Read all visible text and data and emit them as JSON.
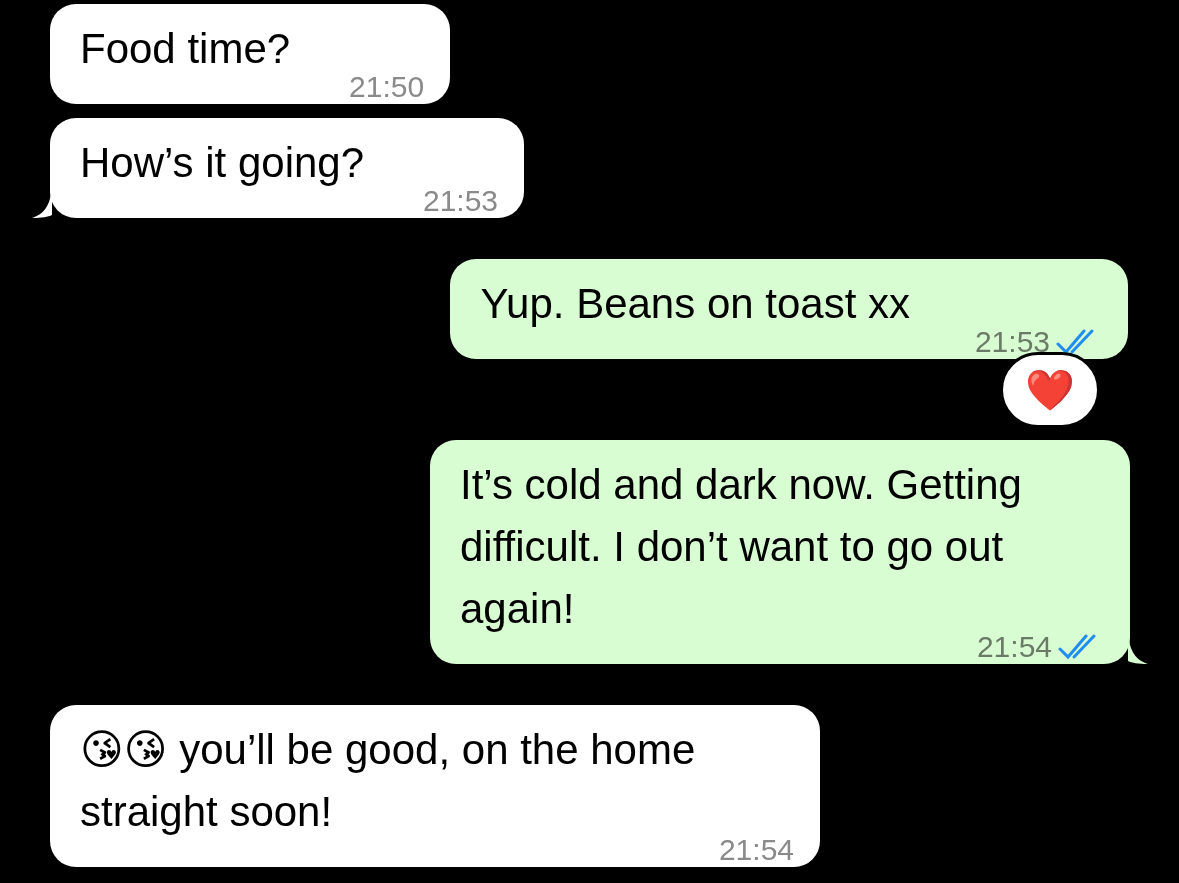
{
  "messages": [
    {
      "kind": "incoming",
      "text": "Food time?",
      "time": "21:50",
      "tail": false
    },
    {
      "kind": "incoming",
      "text": "How’s it going?",
      "time": "21:53",
      "tail": true
    },
    {
      "kind": "outgoing",
      "text": "Yup. Beans on toast xx",
      "time": "21:53",
      "read": true,
      "tail": false,
      "reaction": "❤️"
    },
    {
      "kind": "outgoing",
      "text": "It’s cold and dark now. Getting difficult. I don’t want to go out again!",
      "time": "21:54",
      "read": true,
      "tail": true
    },
    {
      "kind": "incoming",
      "text": "😘😘 you’ll be good, on the home straight soon!",
      "time": "21:54",
      "tail": false
    }
  ]
}
